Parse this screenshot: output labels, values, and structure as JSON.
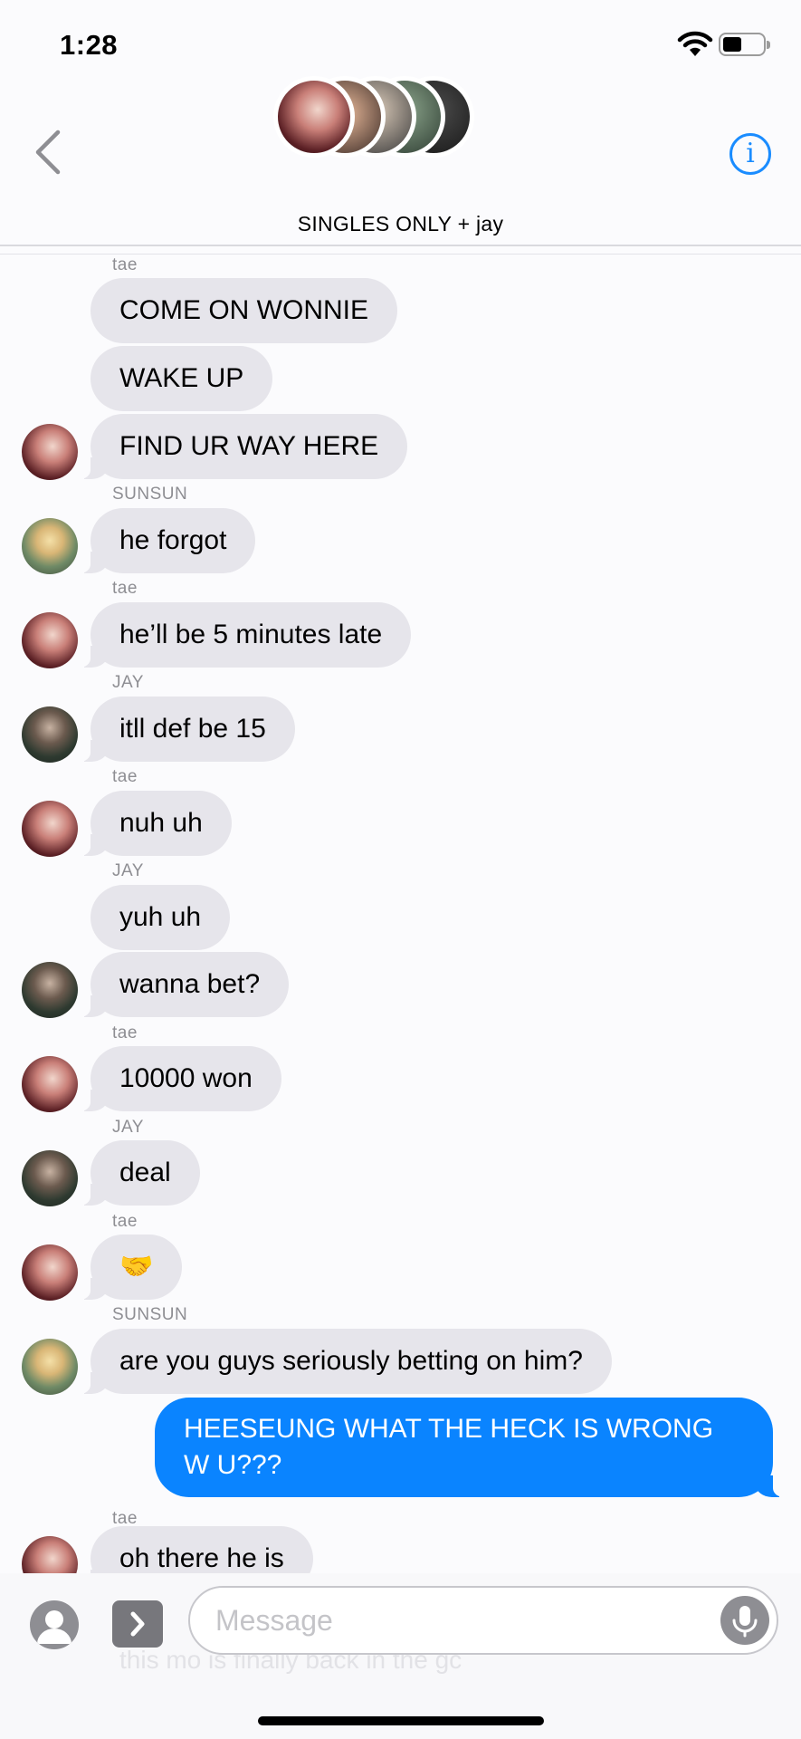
{
  "status_bar": {
    "time": "1:28"
  },
  "header": {
    "group_name": "SINGLES ONLY + jay"
  },
  "messages": [
    {
      "sender": "tae",
      "text": "COME ON WONNIE"
    },
    {
      "text": "WAKE UP"
    },
    {
      "text": "FIND UR WAY HERE",
      "avatar": "tae"
    },
    {
      "sender": "SUNSUN",
      "text": "he forgot",
      "avatar": "sunsun"
    },
    {
      "sender": "tae",
      "text": "he’ll be 5 minutes late",
      "avatar": "tae"
    },
    {
      "sender": "JAY",
      "text": "itll def be 15",
      "avatar": "jay"
    },
    {
      "sender": "tae",
      "text": "nuh uh",
      "avatar": "tae"
    },
    {
      "sender": "JAY",
      "text": "yuh uh"
    },
    {
      "text": "wanna bet?",
      "avatar": "jay"
    },
    {
      "sender": "tae",
      "text": "10000 won",
      "avatar": "tae"
    },
    {
      "sender": "JAY",
      "text": "deal",
      "avatar": "jay"
    },
    {
      "sender": "tae",
      "text": "🤝",
      "avatar": "tae"
    },
    {
      "sender": "SUNSUN",
      "text": "are you guys seriously betting on him?",
      "avatar": "sunsun"
    },
    {
      "mine": true,
      "text": "HEESEUNG WHAT THE HECK IS WRONG W U???"
    },
    {
      "sender": "tae",
      "text": "oh there he is",
      "avatar": "tae"
    },
    {
      "text": "this mo is finally back in the gc"
    }
  ],
  "composer": {
    "placeholder": "Message",
    "value": ""
  }
}
